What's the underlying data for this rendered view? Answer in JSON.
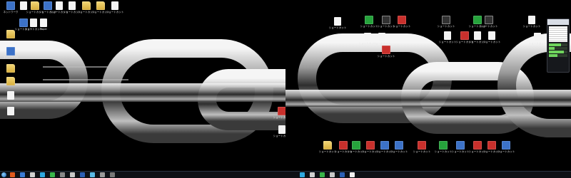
{
  "desktop": {
    "left_icons": [
      {
        "label": "ネットワーク",
        "cls": "exe",
        "icon": "network-icon"
      },
      {
        "label": "",
        "cls": "folder",
        "icon": "folder-icon"
      },
      {
        "label": "ネットワーク",
        "cls": "exe",
        "icon": "network-icon"
      },
      {
        "label": "",
        "cls": "folder",
        "icon": "folder-icon"
      },
      {
        "label": "",
        "cls": "folder",
        "icon": "folder-icon"
      },
      {
        "label": "",
        "cls": "file",
        "icon": "file-icon"
      },
      {
        "label": "",
        "cls": "file",
        "icon": "file-icon"
      }
    ],
    "left_top_row": [
      {
        "label": "",
        "cls": "file",
        "icon": "file-icon"
      },
      {
        "label": "ショートカット",
        "cls": "folder",
        "icon": "folder-icon"
      },
      {
        "label": "ショートカット",
        "cls": "exe",
        "icon": "app-icon"
      },
      {
        "label": "ショートカット",
        "cls": "file",
        "icon": "file-icon"
      },
      {
        "label": "ショートカット",
        "cls": "file",
        "icon": "file-icon"
      },
      {
        "label": "ショートカット",
        "cls": "folder",
        "icon": "folder-icon"
      },
      {
        "label": "ショートカット",
        "cls": "folder",
        "icon": "folder-icon"
      },
      {
        "label": "ショートカット",
        "cls": "file",
        "icon": "file-icon"
      }
    ],
    "left_second_row": [
      {
        "label": "ショートカット",
        "cls": "exe",
        "icon": "app-icon"
      },
      {
        "label": "ショートカット",
        "cls": "file",
        "icon": "file-icon"
      },
      {
        "label": "Paper",
        "cls": "file",
        "icon": "file-icon"
      }
    ],
    "left_bottom_icons": [
      {
        "label": "ショートカット",
        "cls": "red",
        "icon": "app-icon"
      },
      {
        "label": "ショートカット",
        "cls": "file",
        "icon": "file-icon"
      }
    ],
    "right_top_icons": [
      {
        "label": "ショートカット",
        "cls": "file",
        "icon": "file-icon"
      },
      {
        "label": "ショートカット",
        "cls": "green",
        "icon": "app-icon"
      },
      {
        "label": "ショートカット",
        "cls": "dark",
        "icon": "app-icon"
      },
      {
        "label": "ショートカット",
        "cls": "red",
        "icon": "app-icon"
      },
      {
        "label": "ショートカット",
        "cls": "dark",
        "icon": "app-icon"
      },
      {
        "label": "ショートカット",
        "cls": "green",
        "icon": "app-icon"
      },
      {
        "label": "ショートカット",
        "cls": "dark",
        "icon": "app-icon"
      },
      {
        "label": "ショートカット",
        "cls": "file",
        "icon": "file-icon"
      }
    ],
    "right_mid_icons": [
      {
        "label": "ショートカット",
        "cls": "file",
        "icon": "file-icon"
      },
      {
        "label": "ショートカット",
        "cls": "file",
        "icon": "file-icon"
      },
      {
        "label": "ショートカット",
        "cls": "red",
        "icon": "app-icon"
      },
      {
        "label": "ショートカット",
        "cls": "file",
        "icon": "file-icon"
      },
      {
        "label": "ショートカット",
        "cls": "red",
        "icon": "app-icon"
      },
      {
        "label": "ショートカット",
        "cls": "file",
        "icon": "file-icon"
      },
      {
        "label": "ショートカット",
        "cls": "file",
        "icon": "file-icon"
      },
      {
        "label": "ショートカット",
        "cls": "file",
        "icon": "file-icon"
      }
    ],
    "right_bottom_icons": [
      {
        "label": "ショートカット",
        "cls": "folder",
        "icon": "folder-icon"
      },
      {
        "label": "ショートカット",
        "cls": "red",
        "icon": "app-icon"
      },
      {
        "label": "ショートカット",
        "cls": "green",
        "icon": "app-icon"
      },
      {
        "label": "ショートカット",
        "cls": "red",
        "icon": "app-icon"
      },
      {
        "label": "ショートカット",
        "cls": "exe",
        "icon": "app-icon"
      },
      {
        "label": "ショートカット",
        "cls": "exe",
        "icon": "app-icon"
      },
      {
        "label": "ショートカット",
        "cls": "red",
        "icon": "app-icon"
      },
      {
        "label": "ショートカット",
        "cls": "green",
        "icon": "app-icon"
      },
      {
        "label": "ショートカット",
        "cls": "exe",
        "icon": "app-icon"
      },
      {
        "label": "ショートカット",
        "cls": "red",
        "icon": "app-icon"
      },
      {
        "label": "ショートカット",
        "cls": "red",
        "icon": "app-icon"
      },
      {
        "label": "ショートカット",
        "cls": "exe",
        "icon": "app-icon"
      }
    ]
  },
  "taskbar_left": {
    "items": [
      "#e05a1e",
      "#3a7bd5",
      "#d0d0d0",
      "#2ea8e0",
      "#39b54a",
      "#888888",
      "#c8c8c8",
      "#2b5fb5",
      "#59b9e5",
      "#999999",
      "#777777"
    ]
  },
  "taskbar_right": {
    "items": [
      "#2ea8e0",
      "#d0d0d0",
      "#39b54a",
      "#c8c8c8",
      "#2b5fb5",
      "#f0f0f0"
    ]
  },
  "clock_left": "",
  "clock_right": "",
  "widget": {
    "cal_label": "",
    "stat_levels": [
      0.65,
      0.3,
      0.8,
      0.45
    ]
  },
  "colors": {
    "chain_light": "#e8e8e8",
    "chain_mid": "#8a8a8a",
    "chain_dark": "#2a2a2a",
    "taskbar": "#0d1015"
  }
}
